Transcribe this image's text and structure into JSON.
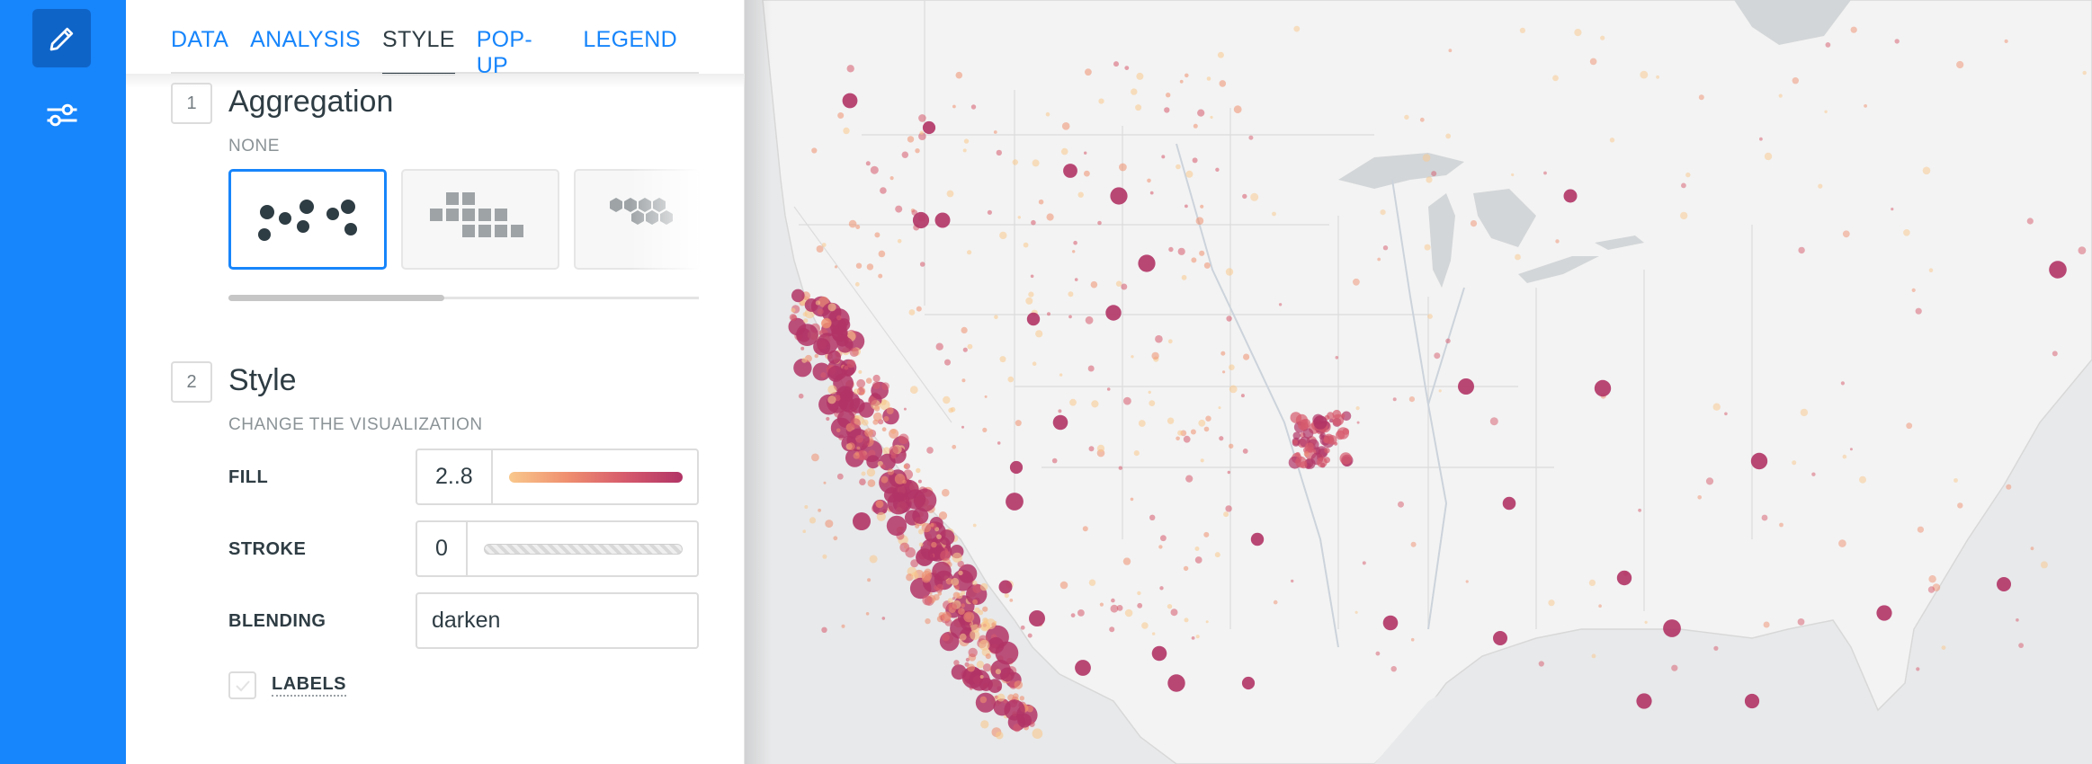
{
  "tabs": [
    {
      "label": "DATA",
      "active": false
    },
    {
      "label": "ANALYSIS",
      "active": false
    },
    {
      "label": "STYLE",
      "active": true
    },
    {
      "label": "POP-UP",
      "active": false
    },
    {
      "label": "LEGEND",
      "active": false
    }
  ],
  "rail": {
    "items": [
      {
        "icon": "pencil-icon",
        "active": true
      },
      {
        "icon": "sliders-icon",
        "active": false
      }
    ]
  },
  "aggregation": {
    "number": "1",
    "title": "Aggregation",
    "subtitle": "NONE",
    "options": [
      {
        "name": "points",
        "selected": true
      },
      {
        "name": "squares",
        "selected": false
      },
      {
        "name": "hexbins",
        "selected": false
      }
    ]
  },
  "style": {
    "number": "2",
    "title": "Style",
    "subtitle": "CHANGE THE VISUALIZATION",
    "fill": {
      "label": "FILL",
      "value": "2..8"
    },
    "stroke": {
      "label": "STROKE",
      "value": "0"
    },
    "blending": {
      "label": "BLENDING",
      "value": "darken"
    },
    "labels": {
      "label": "LABELS",
      "checked": false
    }
  },
  "colors": {
    "accent": "#1785fb",
    "ramp": [
      "#f9c88c",
      "#ef8f6f",
      "#d65a6c",
      "#b13466"
    ]
  }
}
